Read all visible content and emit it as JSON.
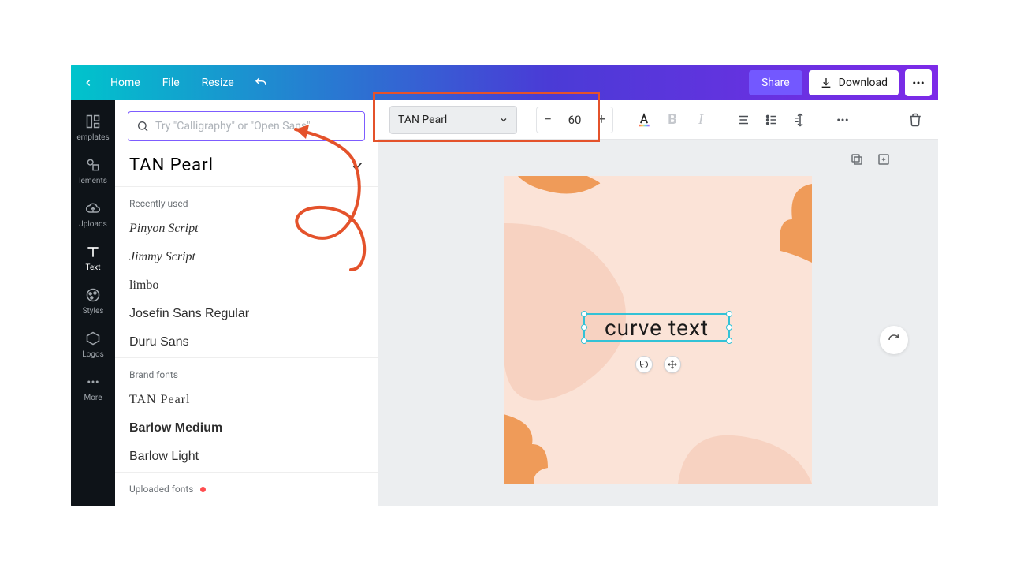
{
  "topbar": {
    "home": "Home",
    "file": "File",
    "resize": "Resize",
    "share": "Share",
    "download": "Download"
  },
  "rail": {
    "templates": "emplates",
    "elements": "lements",
    "uploads": "Jploads",
    "text": "Text",
    "styles": "Styles",
    "logos": "Logos",
    "more": "More"
  },
  "search": {
    "placeholder": "Try \"Calligraphy\" or \"Open Sans\""
  },
  "currentFont": "TAN Pearl",
  "sections": {
    "recent": "Recently used",
    "brand": "Brand fonts",
    "uploaded": "Uploaded fonts"
  },
  "recent": [
    "Pinyon Script",
    "Jimmy Script",
    "limbo",
    "Josefin Sans Regular",
    "Duru Sans"
  ],
  "brand": [
    "TAN Pearl",
    "Barlow Medium",
    "Barlow Light"
  ],
  "toolbar": {
    "fontName": "TAN Pearl",
    "fontSize": "60",
    "bold": "B",
    "italic": "I"
  },
  "canvas": {
    "textContent": "curve text"
  }
}
